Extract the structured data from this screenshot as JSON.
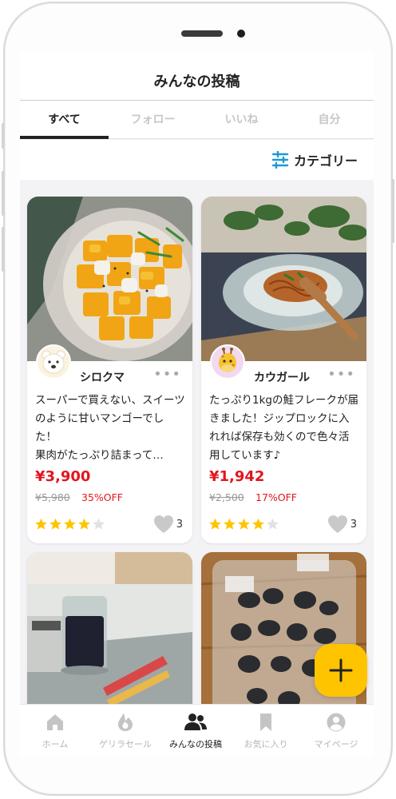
{
  "header": {
    "title": "みんなの投稿"
  },
  "tabs": [
    {
      "label": "すべて",
      "active": true
    },
    {
      "label": "フォロー",
      "active": false
    },
    {
      "label": "いいね",
      "active": false
    },
    {
      "label": "自分",
      "active": false
    }
  ],
  "category": {
    "label": "カテゴリー",
    "icon": "filter-sliders-icon",
    "color": "#1a9ad6"
  },
  "posts": [
    {
      "username": "シロクマ",
      "avatar_icon": "polar-bear-icon",
      "description": "スーパーで買えない、スイーツのように甘いマンゴーでした！\n果肉がたっぷり詰まって…",
      "price": "¥3,900",
      "original_price": "¥5,980",
      "discount": "35%OFF",
      "rating": 4,
      "likes": "3"
    },
    {
      "username": "カウガール",
      "avatar_icon": "giraffe-icon",
      "description": "たっぷり1kgの鮭フレークが届きました！ジップロックに入れれば保存も効くので色々活用しています♪",
      "price": "¥1,942",
      "original_price": "¥2,500",
      "discount": "17%OFF",
      "rating": 4,
      "likes": "3"
    },
    {
      "photo": "iced-coffee-photo"
    },
    {
      "photo": "black-food-bags-photo"
    }
  ],
  "fab": {
    "icon": "plus-icon"
  },
  "bottom_nav": [
    {
      "label": "ホーム",
      "icon": "home-icon",
      "active": false
    },
    {
      "label": "ゲリラセール",
      "icon": "flame-icon",
      "active": false
    },
    {
      "label": "みんなの投稿",
      "icon": "users-icon",
      "active": true
    },
    {
      "label": "お気に入り",
      "icon": "bookmark-icon",
      "active": false
    },
    {
      "label": "マイページ",
      "icon": "profile-icon",
      "active": false
    }
  ],
  "colors": {
    "price": "#e3161d",
    "star": "#ffc400",
    "fab": "#ffc400",
    "accent": "#1a9ad6"
  }
}
